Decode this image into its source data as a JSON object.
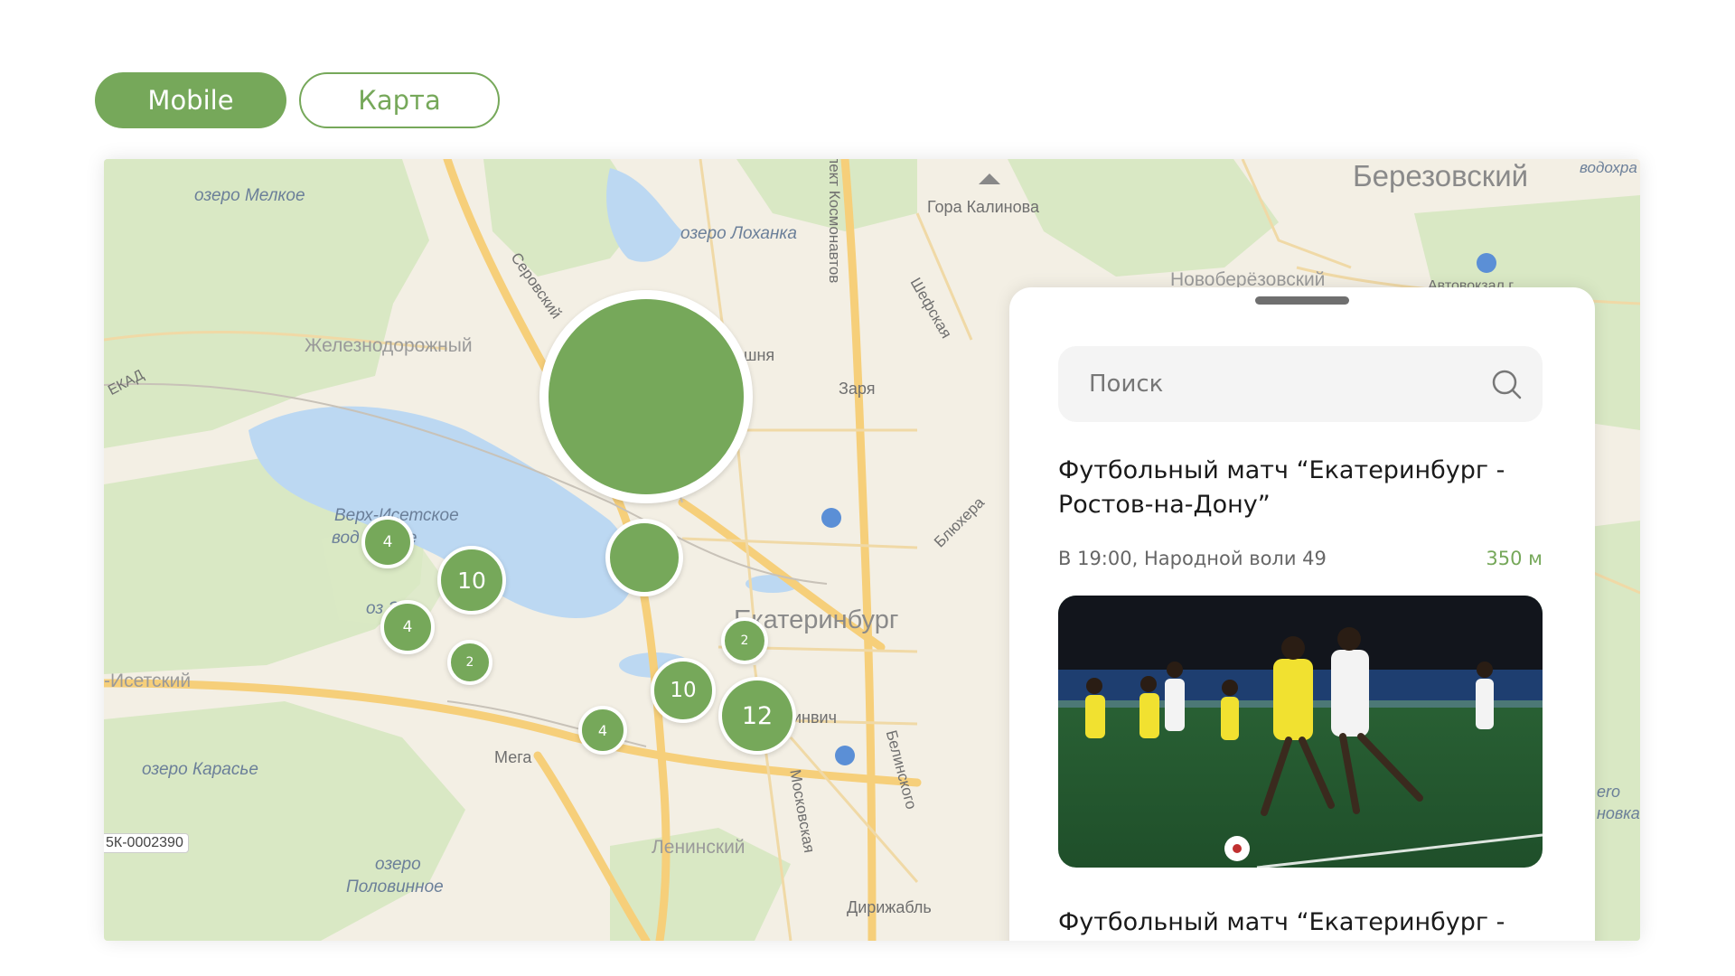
{
  "tabs": [
    {
      "label": "Mobile",
      "active": true
    },
    {
      "label": "Карта",
      "active": false
    }
  ],
  "map": {
    "labels": {
      "lake_melkoe": "озеро Мелкое",
      "lake_lokhanka": "озеро Лоханка",
      "gora_kalinova": "Гора Калинова",
      "berezovsky": "Березовский",
      "vodokhran": "водохра",
      "novoberezovsky": "Новоберёзовский",
      "avtovokzal": "Автовокзал г.",
      "serovsky": "Серовский",
      "kosmonavtov": "пект Космонавтов",
      "shefskaya": "Шефская",
      "zheleznodorozhny": "Железнодорожный",
      "ekad": "ЕКАД",
      "shnya": "шня",
      "zarya": "Заря",
      "verkh_isetskoe_1": "Верх-Исетское",
      "verkh_isetskoe_2": "вод   илище",
      "blukhera": "Блюхера",
      "ozero_zdo": "оз    Здо",
      "ekaterinburg": "Екатеринбург",
      "isetsky": "-Исетский",
      "invich": "инвич",
      "mega": "Мега",
      "lake_karasye": "озеро Карасье",
      "belinskogo": "Белинского",
      "road_code": "5К-0002390",
      "moskovskaya": "Московская",
      "leninsky": "Ленинский",
      "lake_polovinnoe_1": "озеро",
      "lake_polovinnoe_2": "Половинное",
      "dirizhabl": "Дирижабль",
      "right_ero": "ero",
      "right_novka": "новка"
    },
    "clusters": [
      {
        "count": "",
        "size": "large"
      },
      {
        "count": "",
        "size": "medium"
      },
      {
        "count": "4"
      },
      {
        "count": "10"
      },
      {
        "count": "4"
      },
      {
        "count": "2"
      },
      {
        "count": "2"
      },
      {
        "count": "10"
      },
      {
        "count": "12"
      },
      {
        "count": "4"
      }
    ]
  },
  "panel": {
    "search": {
      "placeholder": "Поиск"
    },
    "events": [
      {
        "title_line1": "Футбольный матч “Екатеринбург -",
        "title_line2": "Ростов-на-Дону”",
        "meta": "В 19:00, Народной воли 49",
        "distance": "350 м",
        "photo": "football-match-photo"
      },
      {
        "title_line1": "Футбольный матч “Екатеринбург -"
      }
    ]
  },
  "colors": {
    "accent": "#76a85a",
    "map_bg": "#f3efe4",
    "water": "#bcd8f2",
    "greenery": "#d9e8c4",
    "road": "#f6cf7a"
  }
}
